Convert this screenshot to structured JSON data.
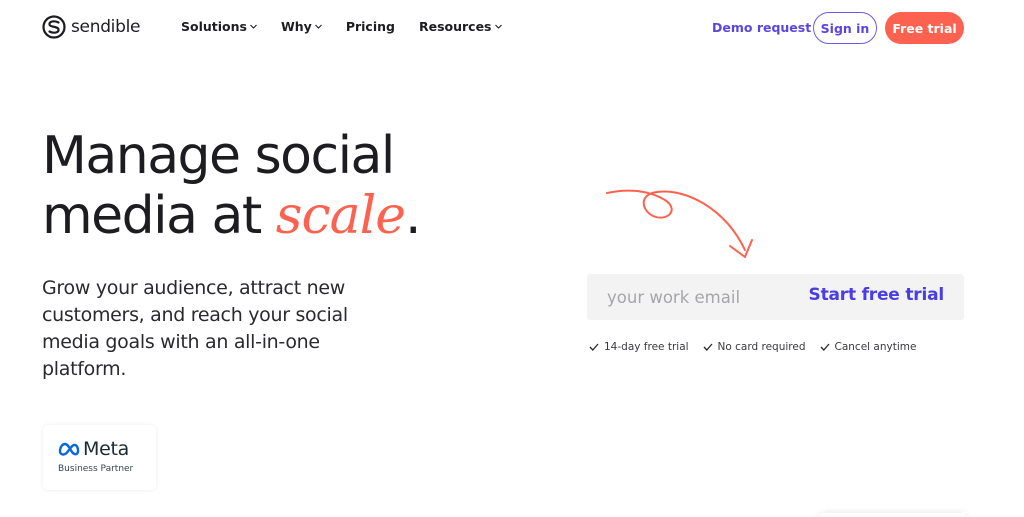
{
  "brand": {
    "name": "sendible",
    "accent_color": "#fd6250",
    "primary_color": "#5b45e0",
    "logo_icon": "sendible-s-logo-icon"
  },
  "nav": {
    "links": [
      {
        "label": "Solutions",
        "has_dropdown": true
      },
      {
        "label": "Why",
        "has_dropdown": true
      },
      {
        "label": "Pricing",
        "has_dropdown": false
      },
      {
        "label": "Resources",
        "has_dropdown": true
      }
    ],
    "demo_label": "Demo request",
    "signin_label": "Sign in",
    "free_trial_label": "Free trial"
  },
  "hero": {
    "headline_line1": "Manage social",
    "headline_line2_start": "media at ",
    "headline_accent": "scale",
    "headline_end": ".",
    "subtitle": "Grow your audience, attract new customers, and reach your social media goals with an all-in-one platform."
  },
  "partner_badge": {
    "brand": "Meta",
    "label": "Business Partner",
    "icon": "meta-infinity-icon"
  },
  "signup": {
    "email_placeholder": "your work email",
    "email_value": "",
    "button_label": "Start free trial",
    "checks": [
      "14-day free trial",
      "No card required",
      "Cancel anytime"
    ]
  }
}
